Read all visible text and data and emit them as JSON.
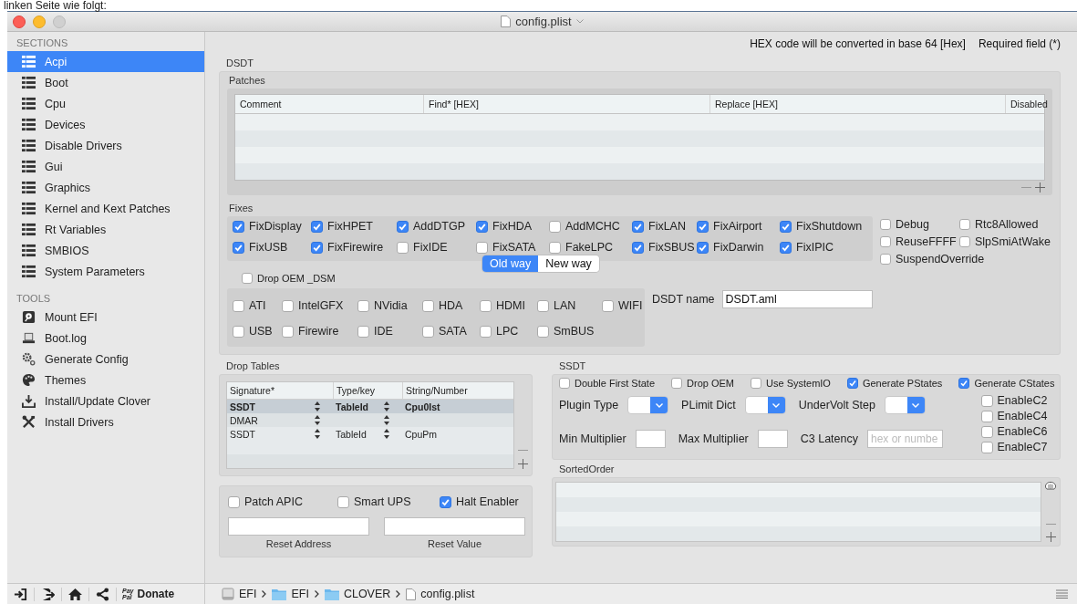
{
  "caption": "linken Seite wie folgt:",
  "window": {
    "title": "config.plist"
  },
  "sidebar": {
    "sections_heading": "SECTIONS",
    "sections": [
      {
        "label": "Acpi",
        "selected": true
      },
      {
        "label": "Boot",
        "selected": false
      },
      {
        "label": "Cpu",
        "selected": false
      },
      {
        "label": "Devices",
        "selected": false
      },
      {
        "label": "Disable Drivers",
        "selected": false
      },
      {
        "label": "Gui",
        "selected": false
      },
      {
        "label": "Graphics",
        "selected": false
      },
      {
        "label": "Kernel and Kext Patches",
        "selected": false
      },
      {
        "label": "Rt Variables",
        "selected": false
      },
      {
        "label": "SMBIOS",
        "selected": false
      },
      {
        "label": "System Parameters",
        "selected": false
      }
    ],
    "tools_heading": "TOOLS",
    "tools": [
      {
        "label": "Mount EFI",
        "kind": "disk"
      },
      {
        "label": "Boot.log",
        "kind": "laptop"
      },
      {
        "label": "Generate Config",
        "kind": "gear"
      },
      {
        "label": "Themes",
        "kind": "palette"
      },
      {
        "label": "Install/Update Clover",
        "kind": "download"
      },
      {
        "label": "Install Drivers",
        "kind": "tools"
      }
    ],
    "donate": {
      "logo_top": "Pay",
      "logo_bottom": "Pal",
      "label": "Donate"
    }
  },
  "header": {
    "hex_note": "HEX code will be converted in base 64 [Hex]",
    "required_note": "Required field (*)"
  },
  "dsdt": {
    "title": "DSDT",
    "patches": {
      "title": "Patches",
      "columns": [
        "Comment",
        "Find* [HEX]",
        "Replace [HEX]",
        "Disabled"
      ]
    },
    "fixes_title": "Fixes",
    "fixes": [
      {
        "label": "FixDisplay",
        "checked": true
      },
      {
        "label": "FixHPET",
        "checked": true
      },
      {
        "label": "AddDTGP",
        "checked": true
      },
      {
        "label": "FixHDA",
        "checked": true
      },
      {
        "label": "AddMCHC",
        "checked": false
      },
      {
        "label": "FixLAN",
        "checked": true
      },
      {
        "label": "FixAirport",
        "checked": true
      },
      {
        "label": "FixShutdown",
        "checked": true
      },
      {
        "label": "FixUSB",
        "checked": true
      },
      {
        "label": "FixFirewire",
        "checked": true
      },
      {
        "label": "FixIDE",
        "checked": false
      },
      {
        "label": "FixSATA",
        "checked": false
      },
      {
        "label": "FakeLPC",
        "checked": false
      },
      {
        "label": "FixSBUS",
        "checked": true
      },
      {
        "label": "FixDarwin",
        "checked": true
      },
      {
        "label": "FixIPIC",
        "checked": true
      }
    ],
    "extra_fixes": [
      {
        "label": "Debug",
        "checked": false
      },
      {
        "label": "Rtc8Allowed",
        "checked": false
      },
      {
        "label": "ReuseFFFF",
        "checked": false
      },
      {
        "label": "SlpSmiAtWake",
        "checked": false
      },
      {
        "label": "SuspendOverride",
        "checked": false
      }
    ],
    "mode": [
      {
        "label": "Old way",
        "selected": true
      },
      {
        "label": "New way",
        "selected": false
      }
    ],
    "drop_oem_dsm": {
      "label": "Drop OEM _DSM",
      "checked": false
    },
    "dsm": [
      {
        "label": "ATI",
        "checked": false
      },
      {
        "label": "IntelGFX",
        "checked": false
      },
      {
        "label": "NVidia",
        "checked": false
      },
      {
        "label": "HDA",
        "checked": false
      },
      {
        "label": "HDMI",
        "checked": false
      },
      {
        "label": "LAN",
        "checked": false
      },
      {
        "label": "WIFI",
        "checked": false
      },
      {
        "label": "USB",
        "checked": false
      },
      {
        "label": "Firewire",
        "checked": false
      },
      {
        "label": "IDE",
        "checked": false
      },
      {
        "label": "SATA",
        "checked": false
      },
      {
        "label": "LPC",
        "checked": false
      },
      {
        "label": "SmBUS",
        "checked": false
      }
    ],
    "dsdt_name": {
      "label": "DSDT name",
      "value": "DSDT.aml"
    }
  },
  "drop_tables": {
    "title": "Drop Tables",
    "columns": [
      "Signature*",
      "Type/key",
      "String/Number"
    ],
    "rows": [
      {
        "signature": "SSDT",
        "type_key": "TableId",
        "string_number": "Cpu0Ist",
        "selected": true
      },
      {
        "signature": "DMAR",
        "type_key": "",
        "string_number": "",
        "selected": false
      },
      {
        "signature": "SSDT",
        "type_key": "TableId",
        "string_number": "CpuPm",
        "selected": false
      }
    ]
  },
  "apic": {
    "checks": [
      {
        "label": "Patch APIC",
        "checked": false
      },
      {
        "label": "Smart UPS",
        "checked": false
      },
      {
        "label": "Halt Enabler",
        "checked": true
      }
    ],
    "fields": [
      {
        "label": "Reset Address"
      },
      {
        "label": "Reset Value"
      }
    ]
  },
  "ssdt": {
    "title": "SSDT",
    "checks": [
      {
        "label": "Double First State",
        "checked": false
      },
      {
        "label": "Drop OEM",
        "checked": false
      },
      {
        "label": "Use SystemIO",
        "checked": false
      },
      {
        "label": "Generate PStates",
        "checked": true
      },
      {
        "label": "Generate CStates",
        "checked": true
      }
    ],
    "dropdowns": [
      {
        "label": "Plugin Type"
      },
      {
        "label": "PLimit Dict"
      },
      {
        "label": "UnderVolt Step"
      }
    ],
    "fields": [
      {
        "label": "Min Multiplier"
      },
      {
        "label": "Max Multiplier"
      },
      {
        "label": "C3 Latency",
        "placeholder": "hex or numbe"
      }
    ],
    "cstates": [
      {
        "label": "EnableC2",
        "checked": false
      },
      {
        "label": "EnableC4",
        "checked": false
      },
      {
        "label": "EnableC6",
        "checked": false
      },
      {
        "label": "EnableC7",
        "checked": false
      }
    ]
  },
  "sorted_order": {
    "title": "SortedOrder"
  },
  "path": [
    {
      "label": "EFI",
      "kind": "drive"
    },
    {
      "label": "EFI",
      "kind": "folder"
    },
    {
      "label": "CLOVER",
      "kind": "folder"
    },
    {
      "label": "config.plist",
      "kind": "file"
    }
  ]
}
